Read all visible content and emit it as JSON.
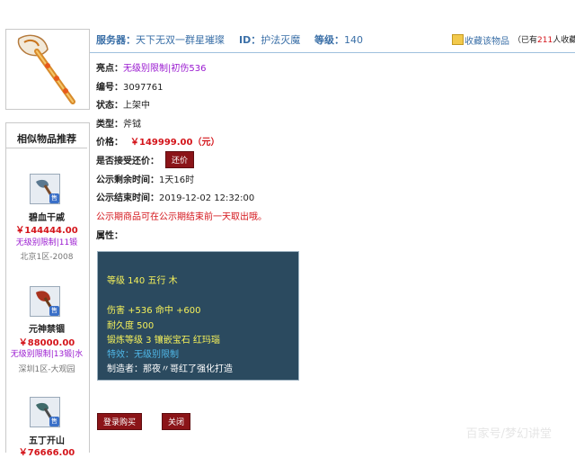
{
  "header": {
    "server_label": "服务器：",
    "server_value": "天下无双一群星璀璨",
    "id_label": "ID：",
    "id_value": "护法灭魔",
    "level_label": "等级：",
    "level_value": "140",
    "favorite_link": "收藏该物品",
    "favorite_count_prefix": "（已有",
    "favorite_count": "211",
    "favorite_count_suffix": "人收藏）"
  },
  "details": {
    "highlight_label": "亮点：",
    "highlight_value": "无级别限制|初伤536",
    "number_label": "编号：",
    "number_value": "3097761",
    "status_label": "状态：",
    "status_value": "上架中",
    "type_label": "类型：",
    "type_value": "斧钺",
    "price_label": "价格：",
    "price_value": "￥149999.00（元）",
    "counter_label": "是否接受还价：",
    "counter_button": "还价",
    "remain_label": "公示剩余时间：",
    "remain_value": "1天16时",
    "end_label": "公示结束时间：",
    "end_value": "2019-12-02 12:32:00",
    "notice": "公示期商品可在公示期结束前一天取出哦。",
    "attr_label": "属性："
  },
  "stats": {
    "line1": "等级 140 五行 木",
    "line2": "伤害 +536 命中 +600",
    "line3": "耐久度 500",
    "line4": "锻炼等级 3 镶嵌宝石 红玛瑙",
    "line5": "特效：无级别限制",
    "line6": "制造者：那夜〃哥红了强化打造"
  },
  "actions": {
    "login_buy": "登录购买",
    "close": "关闭"
  },
  "similar": {
    "title": "相似物品推荐",
    "badge": "售",
    "items": [
      {
        "name": "碧血干戚",
        "price": "￥144444.00",
        "tags": "无级别限制|11锻",
        "server": "北京1区-2008"
      },
      {
        "name": "元神禁锢",
        "price": "￥88000.00",
        "tags": "无级别限制|13锻|水",
        "server": "深圳1区-大观园"
      },
      {
        "name": "五丁开山",
        "price": "￥76666.00",
        "tags": "",
        "server": ""
      }
    ]
  },
  "watermark": "百家号/梦幻讲堂",
  "colors": {
    "accent_blue": "#3a6fa7",
    "price_red": "#d4151b",
    "tag_purple": "#9a1ad0",
    "button_dark_red": "#8b1418",
    "stats_bg": "#2b4a5f",
    "stats_text": "#f6f15a"
  }
}
